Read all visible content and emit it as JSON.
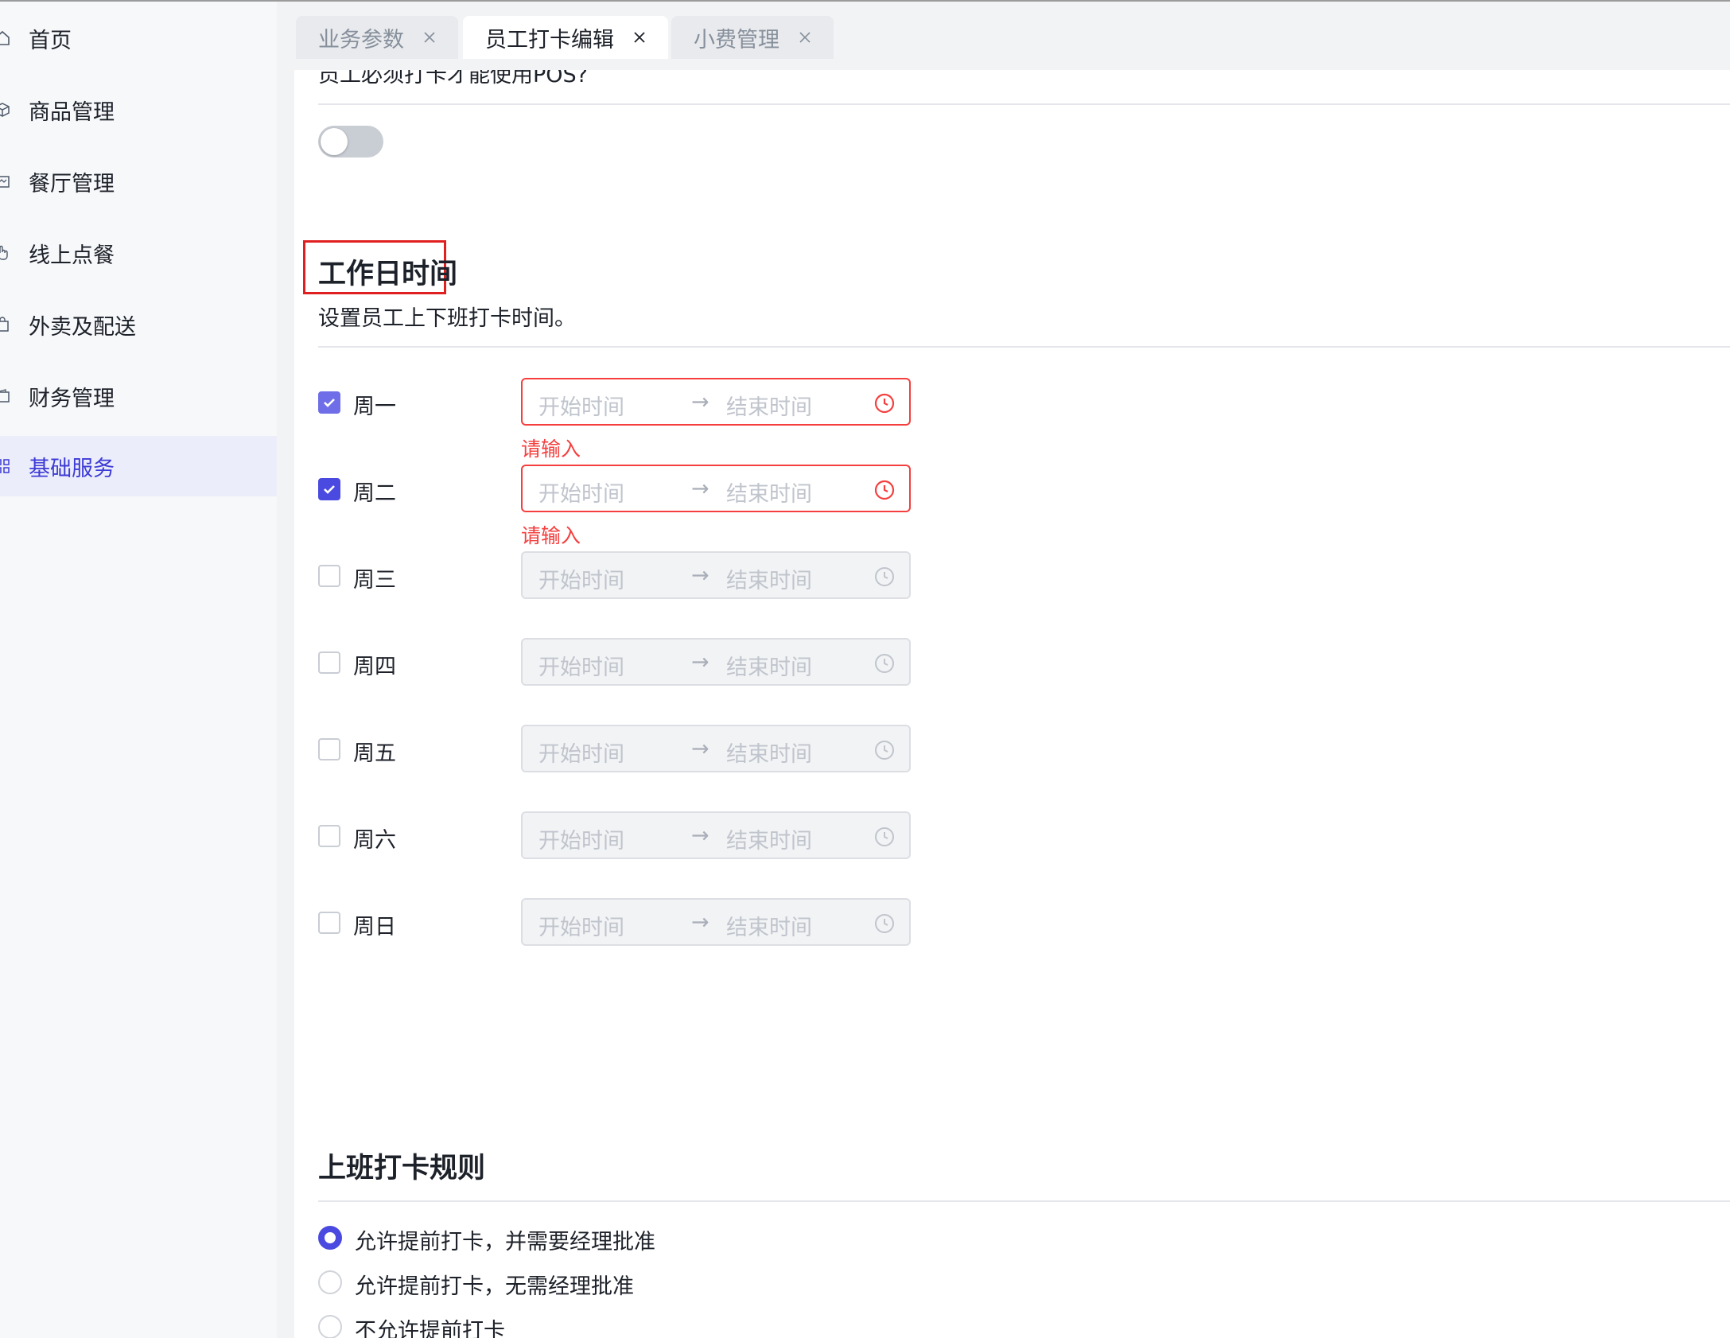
{
  "sidebar": {
    "items": [
      {
        "label": "首页",
        "icon": "home-icon",
        "active": false
      },
      {
        "label": "商品管理",
        "icon": "cube-icon",
        "active": false
      },
      {
        "label": "餐厅管理",
        "icon": "store-icon",
        "active": false
      },
      {
        "label": "线上点餐",
        "icon": "hand-pointer-icon",
        "active": false
      },
      {
        "label": "外卖及配送",
        "icon": "bag-icon",
        "active": false
      },
      {
        "label": "财务管理",
        "icon": "wallet-icon",
        "active": false
      },
      {
        "label": "基础服务",
        "icon": "grid-icon",
        "active": true
      }
    ]
  },
  "tabs": [
    {
      "label": "业务参数",
      "active": false
    },
    {
      "label": "员工打卡编辑",
      "active": true
    },
    {
      "label": "小费管理",
      "active": false
    }
  ],
  "partial_text": "员工必须打卡才能使用POS?",
  "pos_switch": {
    "on": false
  },
  "workday": {
    "title": "工作日时间",
    "description": "设置员工上下班打卡时间。",
    "days": [
      {
        "label": "周一",
        "checked": true,
        "start_placeholder": "开始时间",
        "end_placeholder": "结束时间",
        "error": "请输入"
      },
      {
        "label": "周二",
        "checked": true,
        "start_placeholder": "开始时间",
        "end_placeholder": "结束时间",
        "error": "请输入"
      },
      {
        "label": "周三",
        "checked": false,
        "start_placeholder": "开始时间",
        "end_placeholder": "结束时间",
        "error": ""
      },
      {
        "label": "周四",
        "checked": false,
        "start_placeholder": "开始时间",
        "end_placeholder": "结束时间",
        "error": ""
      },
      {
        "label": "周五",
        "checked": false,
        "start_placeholder": "开始时间",
        "end_placeholder": "结束时间",
        "error": ""
      },
      {
        "label": "周六",
        "checked": false,
        "start_placeholder": "开始时间",
        "end_placeholder": "结束时间",
        "error": ""
      },
      {
        "label": "周日",
        "checked": false,
        "start_placeholder": "开始时间",
        "end_placeholder": "结束时间",
        "error": ""
      }
    ],
    "range_arrow": "→"
  },
  "clock_in_rules": {
    "title": "上班打卡规则",
    "options": [
      {
        "label": "允许提前打卡，并需要经理批准",
        "checked": true
      },
      {
        "label": "允许提前打卡，无需经理批准",
        "checked": false
      },
      {
        "label": "不允许提前打卡",
        "checked": false
      }
    ]
  },
  "colors": {
    "accent": "#4b4ae0",
    "error": "#f53f3f",
    "highlight_box": "#e02020",
    "active_nav_bg": "#ecedfa"
  }
}
